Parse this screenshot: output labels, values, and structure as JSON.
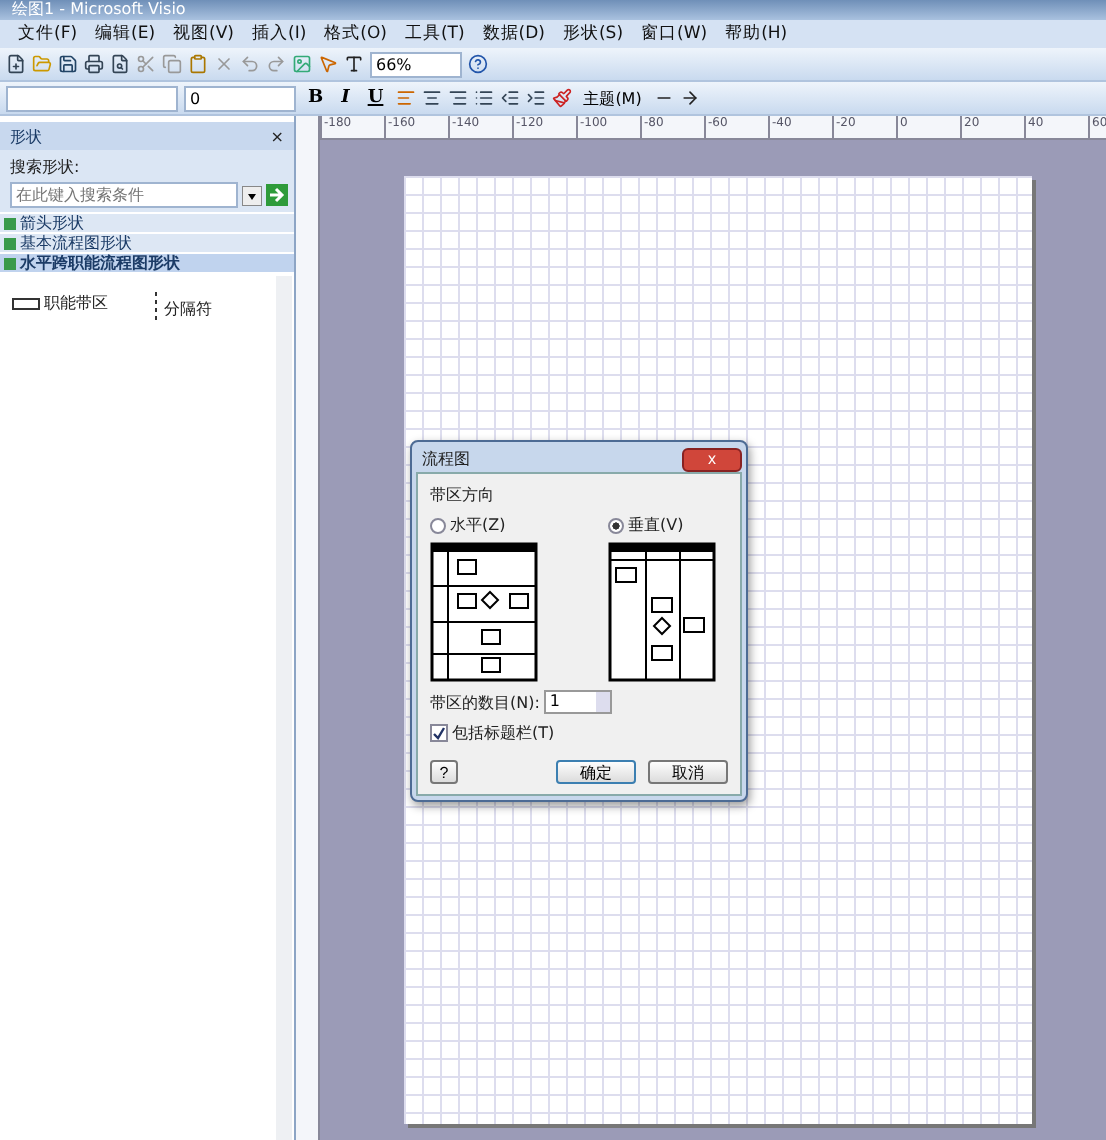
{
  "window": {
    "title": "绘图1 - Microsoft Visio"
  },
  "menu": [
    "文件(F)",
    "编辑(E)",
    "视图(V)",
    "插入(I)",
    "格式(O)",
    "工具(T)",
    "数据(D)",
    "形状(S)",
    "窗口(W)",
    "帮助(H)"
  ],
  "toolbar": {
    "zoom": "66%"
  },
  "format_bar": {
    "font_size": "0",
    "bold": "B",
    "italic": "I",
    "underline": "U",
    "theme": "主题(M)"
  },
  "shapes_panel": {
    "title": "形状",
    "close": "×",
    "search_label": "搜索形状:",
    "search_placeholder": "在此键入搜索条件",
    "stencils": [
      {
        "label": "箭头形状",
        "selected": false
      },
      {
        "label": "基本流程图形状",
        "selected": false
      },
      {
        "label": "水平跨职能流程图形状",
        "selected": true
      }
    ],
    "items": [
      {
        "label": "职能带区",
        "kind": "band"
      },
      {
        "label": "分隔符",
        "kind": "separator"
      }
    ]
  },
  "ruler": {
    "labels": [
      "-180",
      "-160",
      "-140",
      "-120",
      "-100",
      "-80",
      "-60",
      "-40",
      "-20",
      "0",
      "20",
      "40",
      "60"
    ]
  },
  "dialog": {
    "title": "流程图",
    "close": "x",
    "group": "带区方向",
    "options": [
      {
        "label": "水平(Z)",
        "selected": false,
        "kind": "horizontal"
      },
      {
        "label": "垂直(V)",
        "selected": true,
        "kind": "vertical"
      }
    ],
    "count_label": "带区的数目(N):",
    "count": "1",
    "include_title": {
      "label": "包括标题栏(T)",
      "checked": true
    },
    "help": "?",
    "ok": "确定",
    "cancel": "取消"
  }
}
